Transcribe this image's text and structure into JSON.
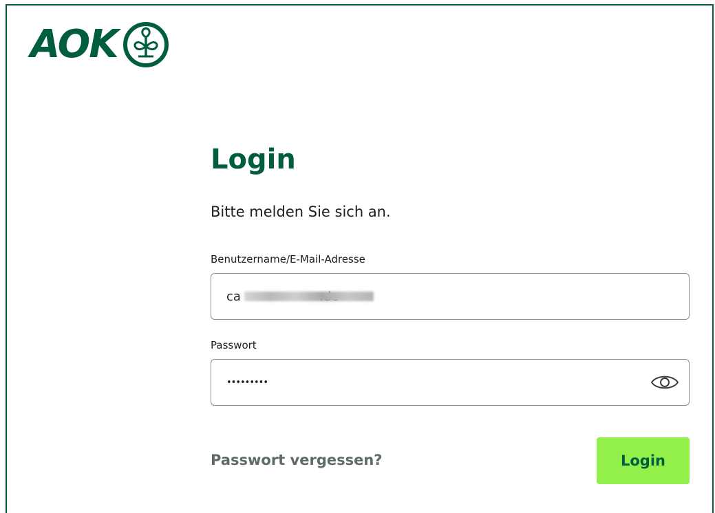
{
  "brand": {
    "name": "AOK",
    "color": "#005e3f",
    "accent": "#93f04a",
    "logo_icon": "aok-tree-emblem-icon"
  },
  "login": {
    "title": "Login",
    "subtitle": "Bitte melden Sie sich an.",
    "username": {
      "label": "Benutzername/E-Mail-Adresse",
      "value": "ca                    .de"
    },
    "password": {
      "label": "Passwort",
      "value": "•••••••••",
      "toggle_icon": "eye-icon"
    },
    "forgot_link": "Passwort vergessen?",
    "submit_label": "Login"
  }
}
